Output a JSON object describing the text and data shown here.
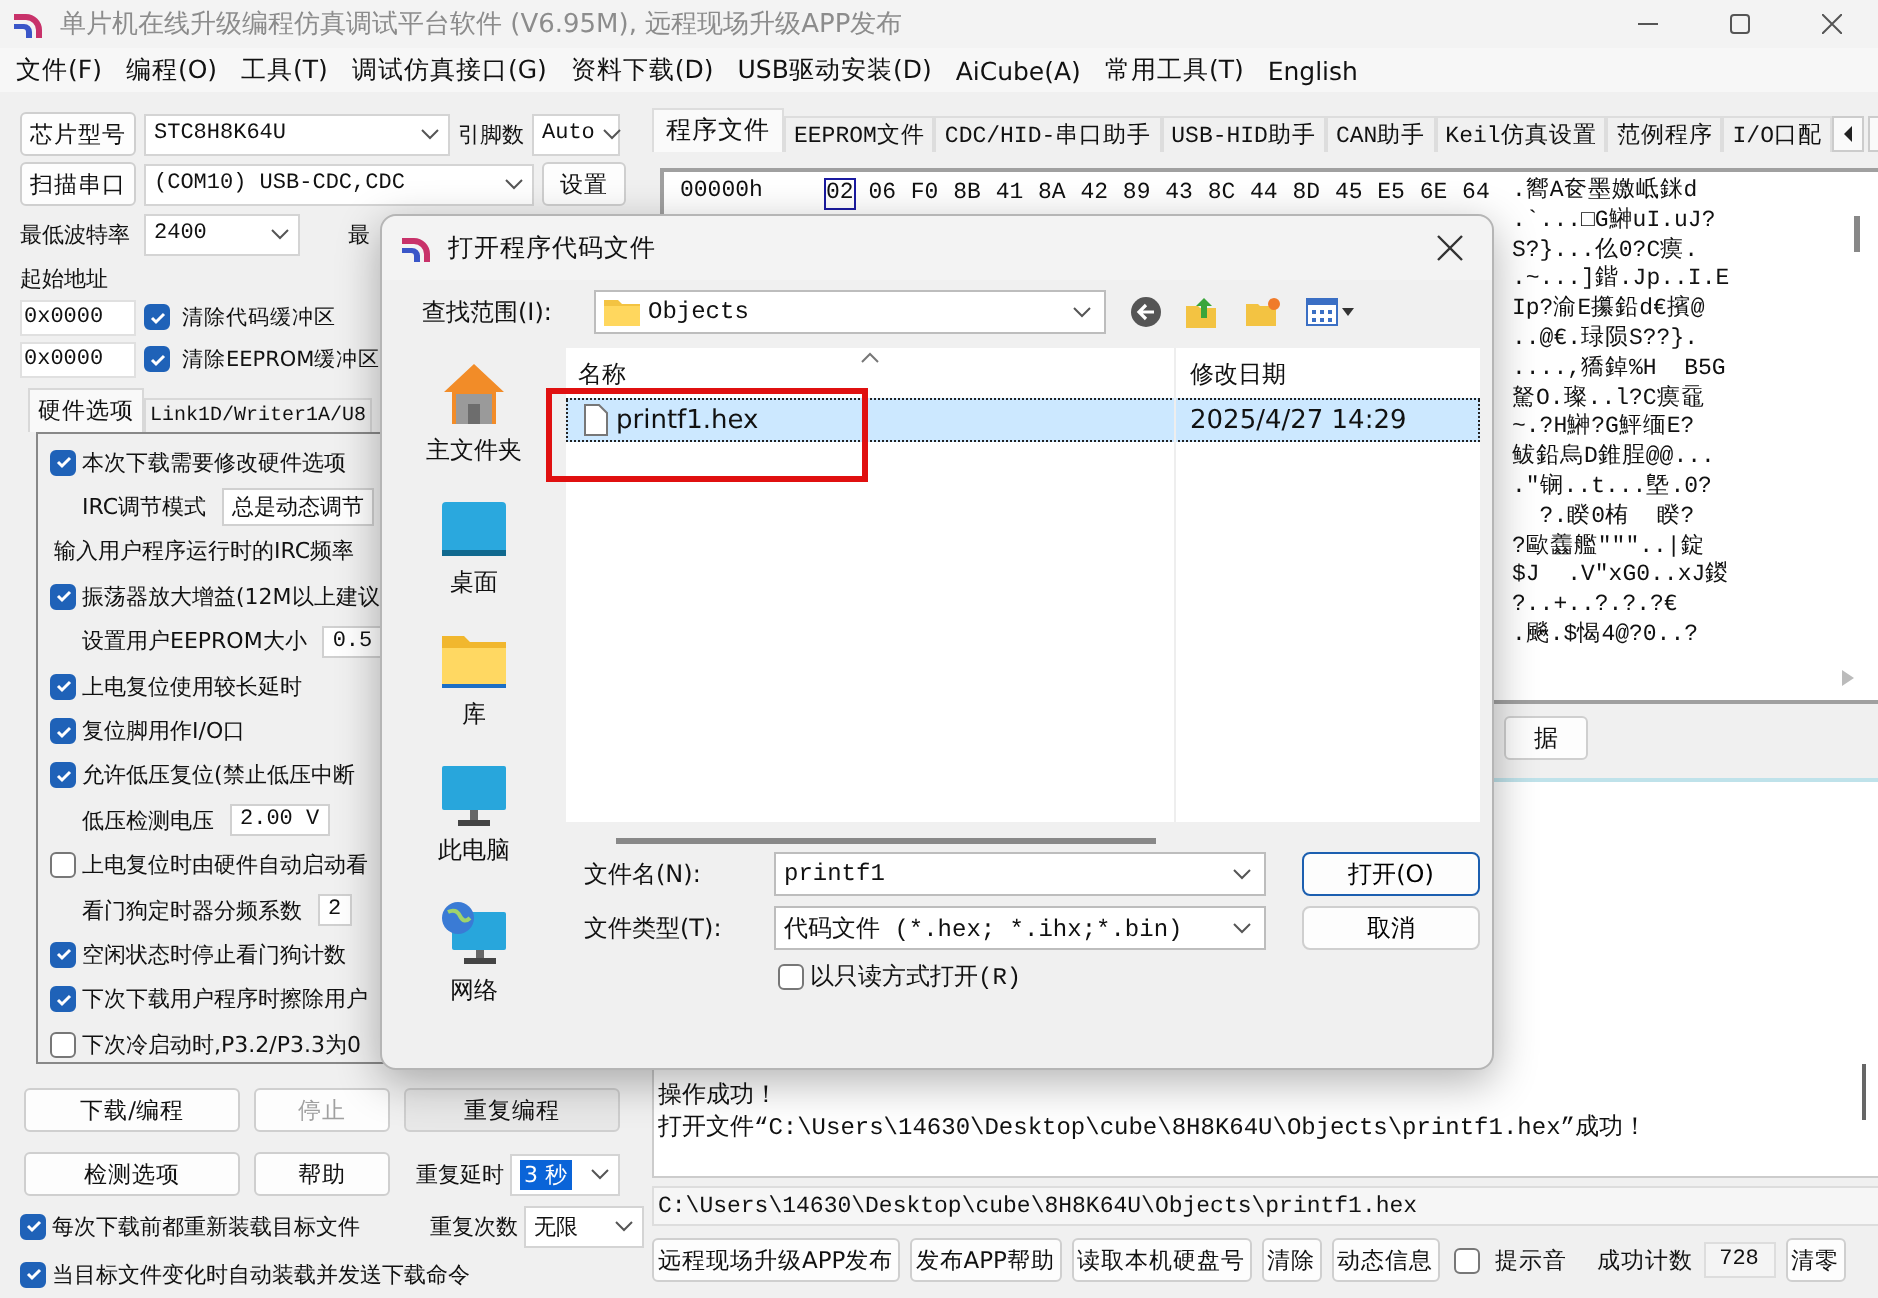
{
  "window": {
    "title": "单片机在线升级编程仿真调试平台软件 (V6.95M), 远程现场升级APP发布"
  },
  "menu": [
    "文件(F)",
    "编程(O)",
    "工具(T)",
    "调试仿真接口(G)",
    "资料下载(D)",
    "USB驱动安装(D)",
    "AiCube(A)",
    "常用工具(T)",
    "English"
  ],
  "chip": {
    "label": "芯片型号",
    "value": "STC8H8K64U",
    "pins_label": "引脚数",
    "pins_value": "Auto"
  },
  "port": {
    "label": "扫描串口",
    "value": "(COM10) USB-CDC,CDC",
    "settings": "设置"
  },
  "baud": {
    "label": "最低波特率",
    "value": "2400",
    "max_label": "最"
  },
  "start_address": {
    "label": "起始地址",
    "fields": [
      {
        "value": "0x0000",
        "label": "清除代码缓冲区",
        "checked": true
      },
      {
        "value": "0x0000",
        "label": "清除EEPROM缓冲区",
        "checked": true
      }
    ]
  },
  "left_tabs": [
    {
      "label": "硬件选项",
      "selected": true
    },
    {
      "label": "Link1D/Writer1A/U8",
      "selected": false
    }
  ],
  "hardware_options": [
    {
      "kind": "check",
      "label": "本次下载需要修改硬件选项",
      "checked": true
    },
    {
      "kind": "select",
      "label": "IRC调节模式",
      "value": "总是动态调节"
    },
    {
      "kind": "text",
      "label": "输入用户程序运行时的IRC频率"
    },
    {
      "kind": "check",
      "label": "振荡器放大增益(12M以上建议",
      "checked": true
    },
    {
      "kind": "select",
      "label": "设置用户EEPROM大小",
      "value": "0.5"
    },
    {
      "kind": "check",
      "label": "上电复位使用较长延时",
      "checked": true
    },
    {
      "kind": "check",
      "label": "复位脚用作I/O口",
      "checked": true
    },
    {
      "kind": "check",
      "label": "允许低压复位(禁止低压中断",
      "checked": true
    },
    {
      "kind": "select",
      "label": "低压检测电压",
      "value": "2.00 V"
    },
    {
      "kind": "check",
      "label": "上电复位时由硬件自动启动看",
      "checked": false
    },
    {
      "kind": "select",
      "label": "看门狗定时器分频系数",
      "value": "2"
    },
    {
      "kind": "check",
      "label": "空闲状态时停止看门狗计数",
      "checked": true
    },
    {
      "kind": "check",
      "label": "下次下载用户程序时擦除用户",
      "checked": true
    },
    {
      "kind": "check",
      "label": "下次冷启动时,P3.2/P3.3为0",
      "checked": false
    }
  ],
  "actions": [
    {
      "label": "下载/编程",
      "disabled": false
    },
    {
      "label": "停止",
      "disabled": true
    },
    {
      "label": "重复编程",
      "disabled": false
    },
    {
      "label": "检测选项",
      "disabled": false
    },
    {
      "label": "帮助",
      "disabled": false
    }
  ],
  "repeat_delay": {
    "label": "重复延时",
    "value": "3 秒"
  },
  "repeat_count": {
    "label": "重复次数",
    "value": "无限"
  },
  "load_options": [
    {
      "label": "每次下载前都重新装载目标文件",
      "checked": true
    },
    {
      "label": "当目标文件变化时自动装载并发送下载命令",
      "checked": true
    }
  ],
  "right_tabs": [
    {
      "label": "程序文件",
      "selected": true
    },
    {
      "label": "EEPROM文件",
      "selected": false
    },
    {
      "label": "CDC/HID-串口助手",
      "selected": false
    },
    {
      "label": "USB-HID助手",
      "selected": false
    },
    {
      "label": "CAN助手",
      "selected": false
    },
    {
      "label": "Keil仿真设置",
      "selected": false
    },
    {
      "label": "范例程序",
      "selected": false
    },
    {
      "label": "I/O口配",
      "selected": false
    }
  ],
  "hex": {
    "address": "00000h",
    "bytes": [
      {
        "value": "02",
        "selected": true
      },
      {
        "value": "06",
        "selected": false
      },
      {
        "value": "F0",
        "selected": false
      },
      {
        "value": "8B",
        "selected": false
      },
      {
        "value": "41",
        "selected": false
      },
      {
        "value": "8A",
        "selected": false
      },
      {
        "value": "42",
        "selected": false
      },
      {
        "value": "89",
        "selected": false
      },
      {
        "value": "43",
        "selected": false
      },
      {
        "value": "8C",
        "selected": false
      },
      {
        "value": "44",
        "selected": false
      },
      {
        "value": "8D",
        "selected": false
      },
      {
        "value": "45",
        "selected": false
      },
      {
        "value": "E5",
        "selected": false
      },
      {
        "value": "6E",
        "selected": false
      },
      {
        "value": "64",
        "selected": false
      }
    ],
    "ascii": [
      ".嚮A奁墨嬓岻銤d",
      ".`...□G鰰uI.uJ?",
      "S?}...仫0?C瘼.",
      ".~...]鍇.Jp..I.E",
      "Ip?渝E攥鉛d€擯@",
      "..@€.琭陨S??}.",
      "....,獢鋽%H  B5G",
      "駑O.璨..l?C瘼黿",
      "~.?H鰰?G鮃缅E?",
      "鲅鉛烏D錐脭@@...",
      ".\"锎..t...墍.0?",
      "  ?.睽0栯  睽?",
      "?歐齹艦\"\"\"..|錠",
      "$J  .V\"xG0..xJ鍐",
      "?..+..?.?.?€",
      ".飈.$愒4@?0..?"
    ]
  },
  "data_button": "据",
  "log": [
    "操作成功！",
    "打开文件“C:\\Users\\14630\\Desktop\\cube\\8H8K64U\\Objects\\printf1.hex”成功！"
  ],
  "path": "C:\\Users\\14630\\Desktop\\cube\\8H8K64U\\Objects\\printf1.hex",
  "bottom_buttons": [
    "远程现场升级APP发布",
    "发布APP帮助",
    "读取本机硬盘号",
    "清除",
    "动态信息"
  ],
  "beep": {
    "label": "提示音",
    "checked": false
  },
  "success_count": {
    "label": "成功计数",
    "value": "728"
  },
  "reset_button": "清零",
  "dialog": {
    "title": "打开程序代码文件",
    "look_in_label": "查找范围(I):",
    "look_in": "Objects",
    "places": [
      {
        "label": "主文件夹",
        "kind": "home"
      },
      {
        "label": "桌面",
        "kind": "desktop"
      },
      {
        "label": "库",
        "kind": "library"
      },
      {
        "label": "此电脑",
        "kind": "computer"
      },
      {
        "label": "网络",
        "kind": "network"
      }
    ],
    "columns": [
      "名称",
      "修改日期"
    ],
    "files": [
      {
        "name": "printf1.hex",
        "modified": "2025/4/27 14:29",
        "selected": true
      }
    ],
    "filename_label": "文件名(N):",
    "filename": "printf1",
    "filetype_label": "文件类型(T):",
    "filetype": "代码文件 (*.hex;  *.ihx;*.bin)",
    "readonly": {
      "label": "以只读方式打开(R)",
      "checked": false
    },
    "open": "打开(O)",
    "cancel": "取消"
  }
}
